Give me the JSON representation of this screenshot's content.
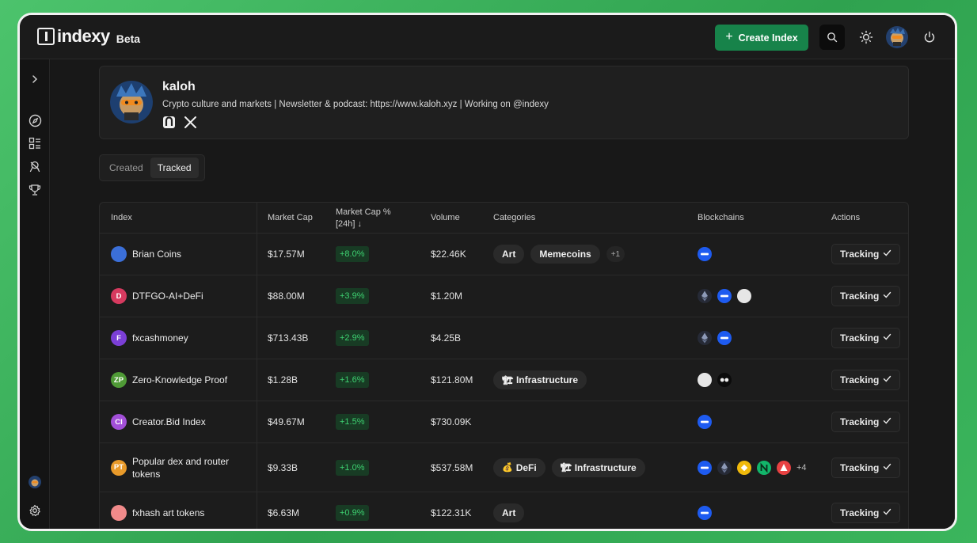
{
  "app": {
    "logo_text": "indexy",
    "beta": "Beta",
    "create_button": "Create Index"
  },
  "profile": {
    "name": "kaloh",
    "bio": "Crypto culture and markets | Newsletter & podcast: https://www.kaloh.xyz | Working on @indexy"
  },
  "tabs": [
    {
      "label": "Created",
      "active": false
    },
    {
      "label": "Tracked",
      "active": true
    }
  ],
  "table": {
    "headers": {
      "index": "Index",
      "market_cap": "Market Cap",
      "market_cap_pct_1": "Market Cap %",
      "market_cap_pct_2": "[24h] ↓",
      "volume": "Volume",
      "categories": "Categories",
      "blockchains": "Blockchains",
      "actions": "Actions"
    },
    "rows": [
      {
        "name": "Brian Coins",
        "icon_text": "",
        "icon_color": "#3b6fd8",
        "market_cap": "$17.57M",
        "pct": "+8.0%",
        "volume": "$22.46K",
        "categories": [
          "Art",
          "Memecoins"
        ],
        "categories_more": "+1",
        "chains": [
          "base"
        ],
        "chains_more": "",
        "action": "Tracking"
      },
      {
        "name": "DTFGO-AI+DeFi",
        "icon_text": "D",
        "icon_color": "#d63a5f",
        "market_cap": "$88.00M",
        "pct": "+3.9%",
        "volume": "$1.20M",
        "categories": [],
        "categories_more": "",
        "chains": [
          "eth",
          "base",
          "white"
        ],
        "chains_more": "",
        "action": "Tracking"
      },
      {
        "name": "fxcashmoney",
        "icon_text": "F",
        "icon_color": "#7b3fd6",
        "market_cap": "$713.43B",
        "pct": "+2.9%",
        "volume": "$4.25B",
        "categories": [],
        "categories_more": "",
        "chains": [
          "eth",
          "base"
        ],
        "chains_more": "",
        "action": "Tracking"
      },
      {
        "name": "Zero-Knowledge Proof",
        "icon_text": "ZP",
        "icon_color": "#4f9a36",
        "market_cap": "$1.28B",
        "pct": "+1.6%",
        "volume": "$121.80M",
        "categories": [
          "Infrastructure"
        ],
        "categories_more": "",
        "chains": [
          "white",
          "dark"
        ],
        "chains_more": "",
        "action": "Tracking"
      },
      {
        "name": "Creator.Bid Index",
        "icon_text": "CI",
        "icon_color": "#a24fd8",
        "market_cap": "$49.67M",
        "pct": "+1.5%",
        "volume": "$730.09K",
        "categories": [],
        "categories_more": "",
        "chains": [
          "base"
        ],
        "chains_more": "",
        "action": "Tracking"
      },
      {
        "name": "Popular dex and router tokens",
        "icon_text": "PT",
        "icon_color": "#e89a2a",
        "market_cap": "$9.33B",
        "pct": "+1.0%",
        "volume": "$537.58M",
        "categories": [
          "DeFi",
          "Infrastructure"
        ],
        "categories_more": "",
        "chains": [
          "base",
          "eth",
          "bnb",
          "green",
          "red"
        ],
        "chains_more": "+4",
        "action": "Tracking"
      },
      {
        "name": "fxhash art tokens",
        "icon_text": "",
        "icon_color": "#f08a8a",
        "market_cap": "$6.63M",
        "pct": "+0.9%",
        "volume": "$122.31K",
        "categories": [
          "Art"
        ],
        "categories_more": "",
        "chains": [
          "base"
        ],
        "chains_more": "",
        "action": "Tracking"
      }
    ]
  },
  "colors": {
    "accent": "#17834a",
    "positive": "#3ed171",
    "base_chain": "#1e5bf0"
  }
}
